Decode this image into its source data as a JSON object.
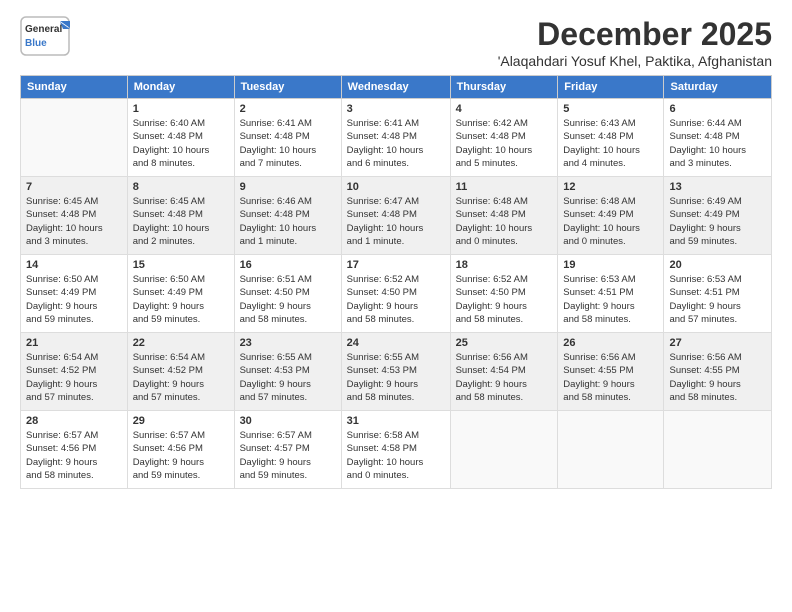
{
  "logo": {
    "line1": "General",
    "line2": "Blue"
  },
  "title": "December 2025",
  "location": "'Alaqahdari Yosuf Khel, Paktika, Afghanistan",
  "headers": [
    "Sunday",
    "Monday",
    "Tuesday",
    "Wednesday",
    "Thursday",
    "Friday",
    "Saturday"
  ],
  "weeks": [
    [
      {
        "day": "",
        "info": ""
      },
      {
        "day": "1",
        "info": "Sunrise: 6:40 AM\nSunset: 4:48 PM\nDaylight: 10 hours\nand 8 minutes."
      },
      {
        "day": "2",
        "info": "Sunrise: 6:41 AM\nSunset: 4:48 PM\nDaylight: 10 hours\nand 7 minutes."
      },
      {
        "day": "3",
        "info": "Sunrise: 6:41 AM\nSunset: 4:48 PM\nDaylight: 10 hours\nand 6 minutes."
      },
      {
        "day": "4",
        "info": "Sunrise: 6:42 AM\nSunset: 4:48 PM\nDaylight: 10 hours\nand 5 minutes."
      },
      {
        "day": "5",
        "info": "Sunrise: 6:43 AM\nSunset: 4:48 PM\nDaylight: 10 hours\nand 4 minutes."
      },
      {
        "day": "6",
        "info": "Sunrise: 6:44 AM\nSunset: 4:48 PM\nDaylight: 10 hours\nand 3 minutes."
      }
    ],
    [
      {
        "day": "7",
        "info": "Sunrise: 6:45 AM\nSunset: 4:48 PM\nDaylight: 10 hours\nand 3 minutes."
      },
      {
        "day": "8",
        "info": "Sunrise: 6:45 AM\nSunset: 4:48 PM\nDaylight: 10 hours\nand 2 minutes."
      },
      {
        "day": "9",
        "info": "Sunrise: 6:46 AM\nSunset: 4:48 PM\nDaylight: 10 hours\nand 1 minute."
      },
      {
        "day": "10",
        "info": "Sunrise: 6:47 AM\nSunset: 4:48 PM\nDaylight: 10 hours\nand 1 minute."
      },
      {
        "day": "11",
        "info": "Sunrise: 6:48 AM\nSunset: 4:48 PM\nDaylight: 10 hours\nand 0 minutes."
      },
      {
        "day": "12",
        "info": "Sunrise: 6:48 AM\nSunset: 4:49 PM\nDaylight: 10 hours\nand 0 minutes."
      },
      {
        "day": "13",
        "info": "Sunrise: 6:49 AM\nSunset: 4:49 PM\nDaylight: 9 hours\nand 59 minutes."
      }
    ],
    [
      {
        "day": "14",
        "info": "Sunrise: 6:50 AM\nSunset: 4:49 PM\nDaylight: 9 hours\nand 59 minutes."
      },
      {
        "day": "15",
        "info": "Sunrise: 6:50 AM\nSunset: 4:49 PM\nDaylight: 9 hours\nand 59 minutes."
      },
      {
        "day": "16",
        "info": "Sunrise: 6:51 AM\nSunset: 4:50 PM\nDaylight: 9 hours\nand 58 minutes."
      },
      {
        "day": "17",
        "info": "Sunrise: 6:52 AM\nSunset: 4:50 PM\nDaylight: 9 hours\nand 58 minutes."
      },
      {
        "day": "18",
        "info": "Sunrise: 6:52 AM\nSunset: 4:50 PM\nDaylight: 9 hours\nand 58 minutes."
      },
      {
        "day": "19",
        "info": "Sunrise: 6:53 AM\nSunset: 4:51 PM\nDaylight: 9 hours\nand 58 minutes."
      },
      {
        "day": "20",
        "info": "Sunrise: 6:53 AM\nSunset: 4:51 PM\nDaylight: 9 hours\nand 57 minutes."
      }
    ],
    [
      {
        "day": "21",
        "info": "Sunrise: 6:54 AM\nSunset: 4:52 PM\nDaylight: 9 hours\nand 57 minutes."
      },
      {
        "day": "22",
        "info": "Sunrise: 6:54 AM\nSunset: 4:52 PM\nDaylight: 9 hours\nand 57 minutes."
      },
      {
        "day": "23",
        "info": "Sunrise: 6:55 AM\nSunset: 4:53 PM\nDaylight: 9 hours\nand 57 minutes."
      },
      {
        "day": "24",
        "info": "Sunrise: 6:55 AM\nSunset: 4:53 PM\nDaylight: 9 hours\nand 58 minutes."
      },
      {
        "day": "25",
        "info": "Sunrise: 6:56 AM\nSunset: 4:54 PM\nDaylight: 9 hours\nand 58 minutes."
      },
      {
        "day": "26",
        "info": "Sunrise: 6:56 AM\nSunset: 4:55 PM\nDaylight: 9 hours\nand 58 minutes."
      },
      {
        "day": "27",
        "info": "Sunrise: 6:56 AM\nSunset: 4:55 PM\nDaylight: 9 hours\nand 58 minutes."
      }
    ],
    [
      {
        "day": "28",
        "info": "Sunrise: 6:57 AM\nSunset: 4:56 PM\nDaylight: 9 hours\nand 58 minutes."
      },
      {
        "day": "29",
        "info": "Sunrise: 6:57 AM\nSunset: 4:56 PM\nDaylight: 9 hours\nand 59 minutes."
      },
      {
        "day": "30",
        "info": "Sunrise: 6:57 AM\nSunset: 4:57 PM\nDaylight: 9 hours\nand 59 minutes."
      },
      {
        "day": "31",
        "info": "Sunrise: 6:58 AM\nSunset: 4:58 PM\nDaylight: 10 hours\nand 0 minutes."
      },
      {
        "day": "",
        "info": ""
      },
      {
        "day": "",
        "info": ""
      },
      {
        "day": "",
        "info": ""
      }
    ]
  ]
}
